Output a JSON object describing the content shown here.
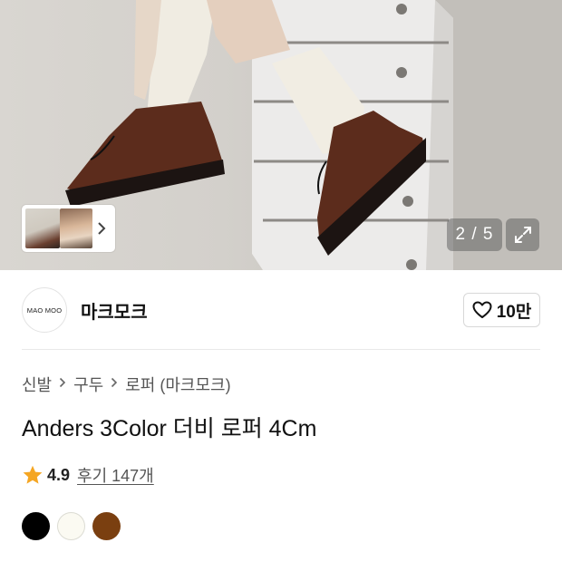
{
  "gallery": {
    "counter_current": "2",
    "counter_total": "5",
    "counter_text": "2 / 5",
    "thumbnails": [
      "thumb-1",
      "thumb-2"
    ],
    "icons": {
      "next": "chevron-right-icon",
      "expand": "expand-icon"
    }
  },
  "brand": {
    "logo_text": "MAO MOO",
    "name": "마크모크",
    "like_count": "10만",
    "like_icon": "heart-outline-icon"
  },
  "breadcrumb": {
    "items": [
      "신발",
      "구두",
      "로퍼 (마크모크)"
    ]
  },
  "product": {
    "title": "Anders 3Color 더비 로퍼 4Cm",
    "rating": "4.9",
    "review_text": "후기 147개",
    "rating_icon": "star-icon",
    "rating_color": "#F5A623"
  },
  "colors": [
    "#000000",
    "#FBFAF2",
    "#7A3F10"
  ]
}
